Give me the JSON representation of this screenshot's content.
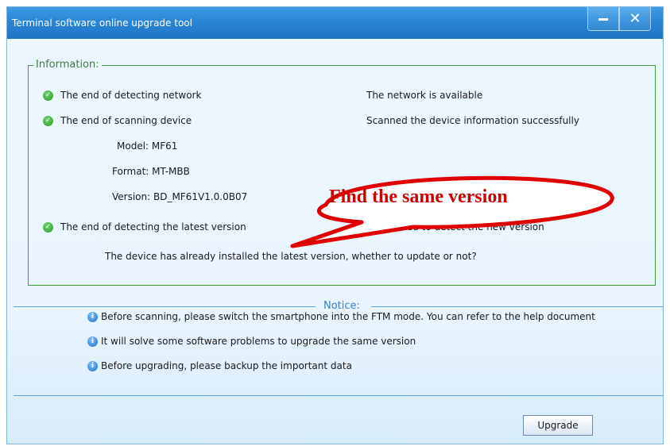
{
  "window": {
    "title": "Terminal software online upgrade tool",
    "minimize_icon": "minimize-icon",
    "close_icon": "close-icon"
  },
  "information": {
    "legend": "Information:",
    "network_status": "The end of detecting network",
    "network_result": "The network is available",
    "scan_status": "The end of scanning device",
    "scan_result": "Scanned the device information successfully",
    "model": "Model: MF61",
    "format": "Format: MT-MBB",
    "version": "Version: BD_MF61V1.0.0B07",
    "latest_status": "The end of detecting the latest version",
    "latest_result": "Succeeded to detect the new version",
    "prompt": "The device has already installed the latest version, whether to update or not?"
  },
  "notice": {
    "legend": "Notice:",
    "items": [
      "Before scanning, please switch the smartphone into the FTM mode. You can refer to the help document",
      "It will solve some software problems to upgrade the same version",
      "Before upgrading, please backup the important data"
    ]
  },
  "actions": {
    "upgrade_label": "Upgrade"
  },
  "annotation": {
    "callout_text": "Find the same version",
    "color": "#cc0000"
  },
  "colors": {
    "titlebar": "#2a85d5",
    "info_border": "#3d9a3d",
    "success_icon": "#2e9a2e",
    "notice_icon": "#1f6fcc"
  }
}
